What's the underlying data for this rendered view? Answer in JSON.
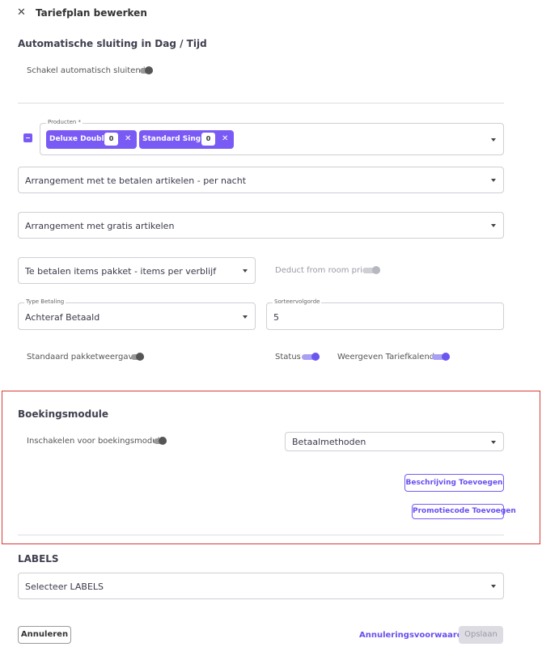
{
  "header": {
    "title": "Tariefplan bewerken"
  },
  "auto_close": {
    "title": "Automatische sluiting in Dag / Tijd",
    "toggle_label": "Schakel automatisch sluiten in"
  },
  "products": {
    "label": "Producten *",
    "chips": [
      {
        "label": "Deluxe Double",
        "count": "0"
      },
      {
        "label": "Standard Single",
        "count": "0"
      }
    ]
  },
  "selects": {
    "paid_arrangement": "Arrangement met te betalen artikelen - per nacht",
    "free_arrangement": "Arrangement met gratis artikelen",
    "package": "Te betalen items pakket - items per verblijf"
  },
  "deduct": {
    "label": "Deduct from room price"
  },
  "payment_type": {
    "label": "Type Betaling",
    "value": "Achteraf Betaald"
  },
  "sort_order": {
    "label": "Sorteervolgorde",
    "value": "5"
  },
  "toggles": {
    "default_package_view": "Standaard pakketweergave",
    "status": "Status",
    "show_calendar": "Weergeven Tariefkalender"
  },
  "booking": {
    "title": "Boekingsmodule",
    "enable_label": "Inschakelen voor boekingsmodule",
    "payment_methods": "Betaalmethoden",
    "add_description": "Beschrijving Toevoegen",
    "add_promo": "Promotiecode Toevoegen"
  },
  "labels": {
    "title": "LABELS",
    "select": "Selecteer LABELS"
  },
  "footer": {
    "cancel": "Annuleren",
    "cancellation_terms": "Annuleringsvoorwaarden",
    "save": "Opslaan"
  },
  "colors": {
    "accent": "#7a5af5",
    "highlight": "#d83a3a"
  }
}
